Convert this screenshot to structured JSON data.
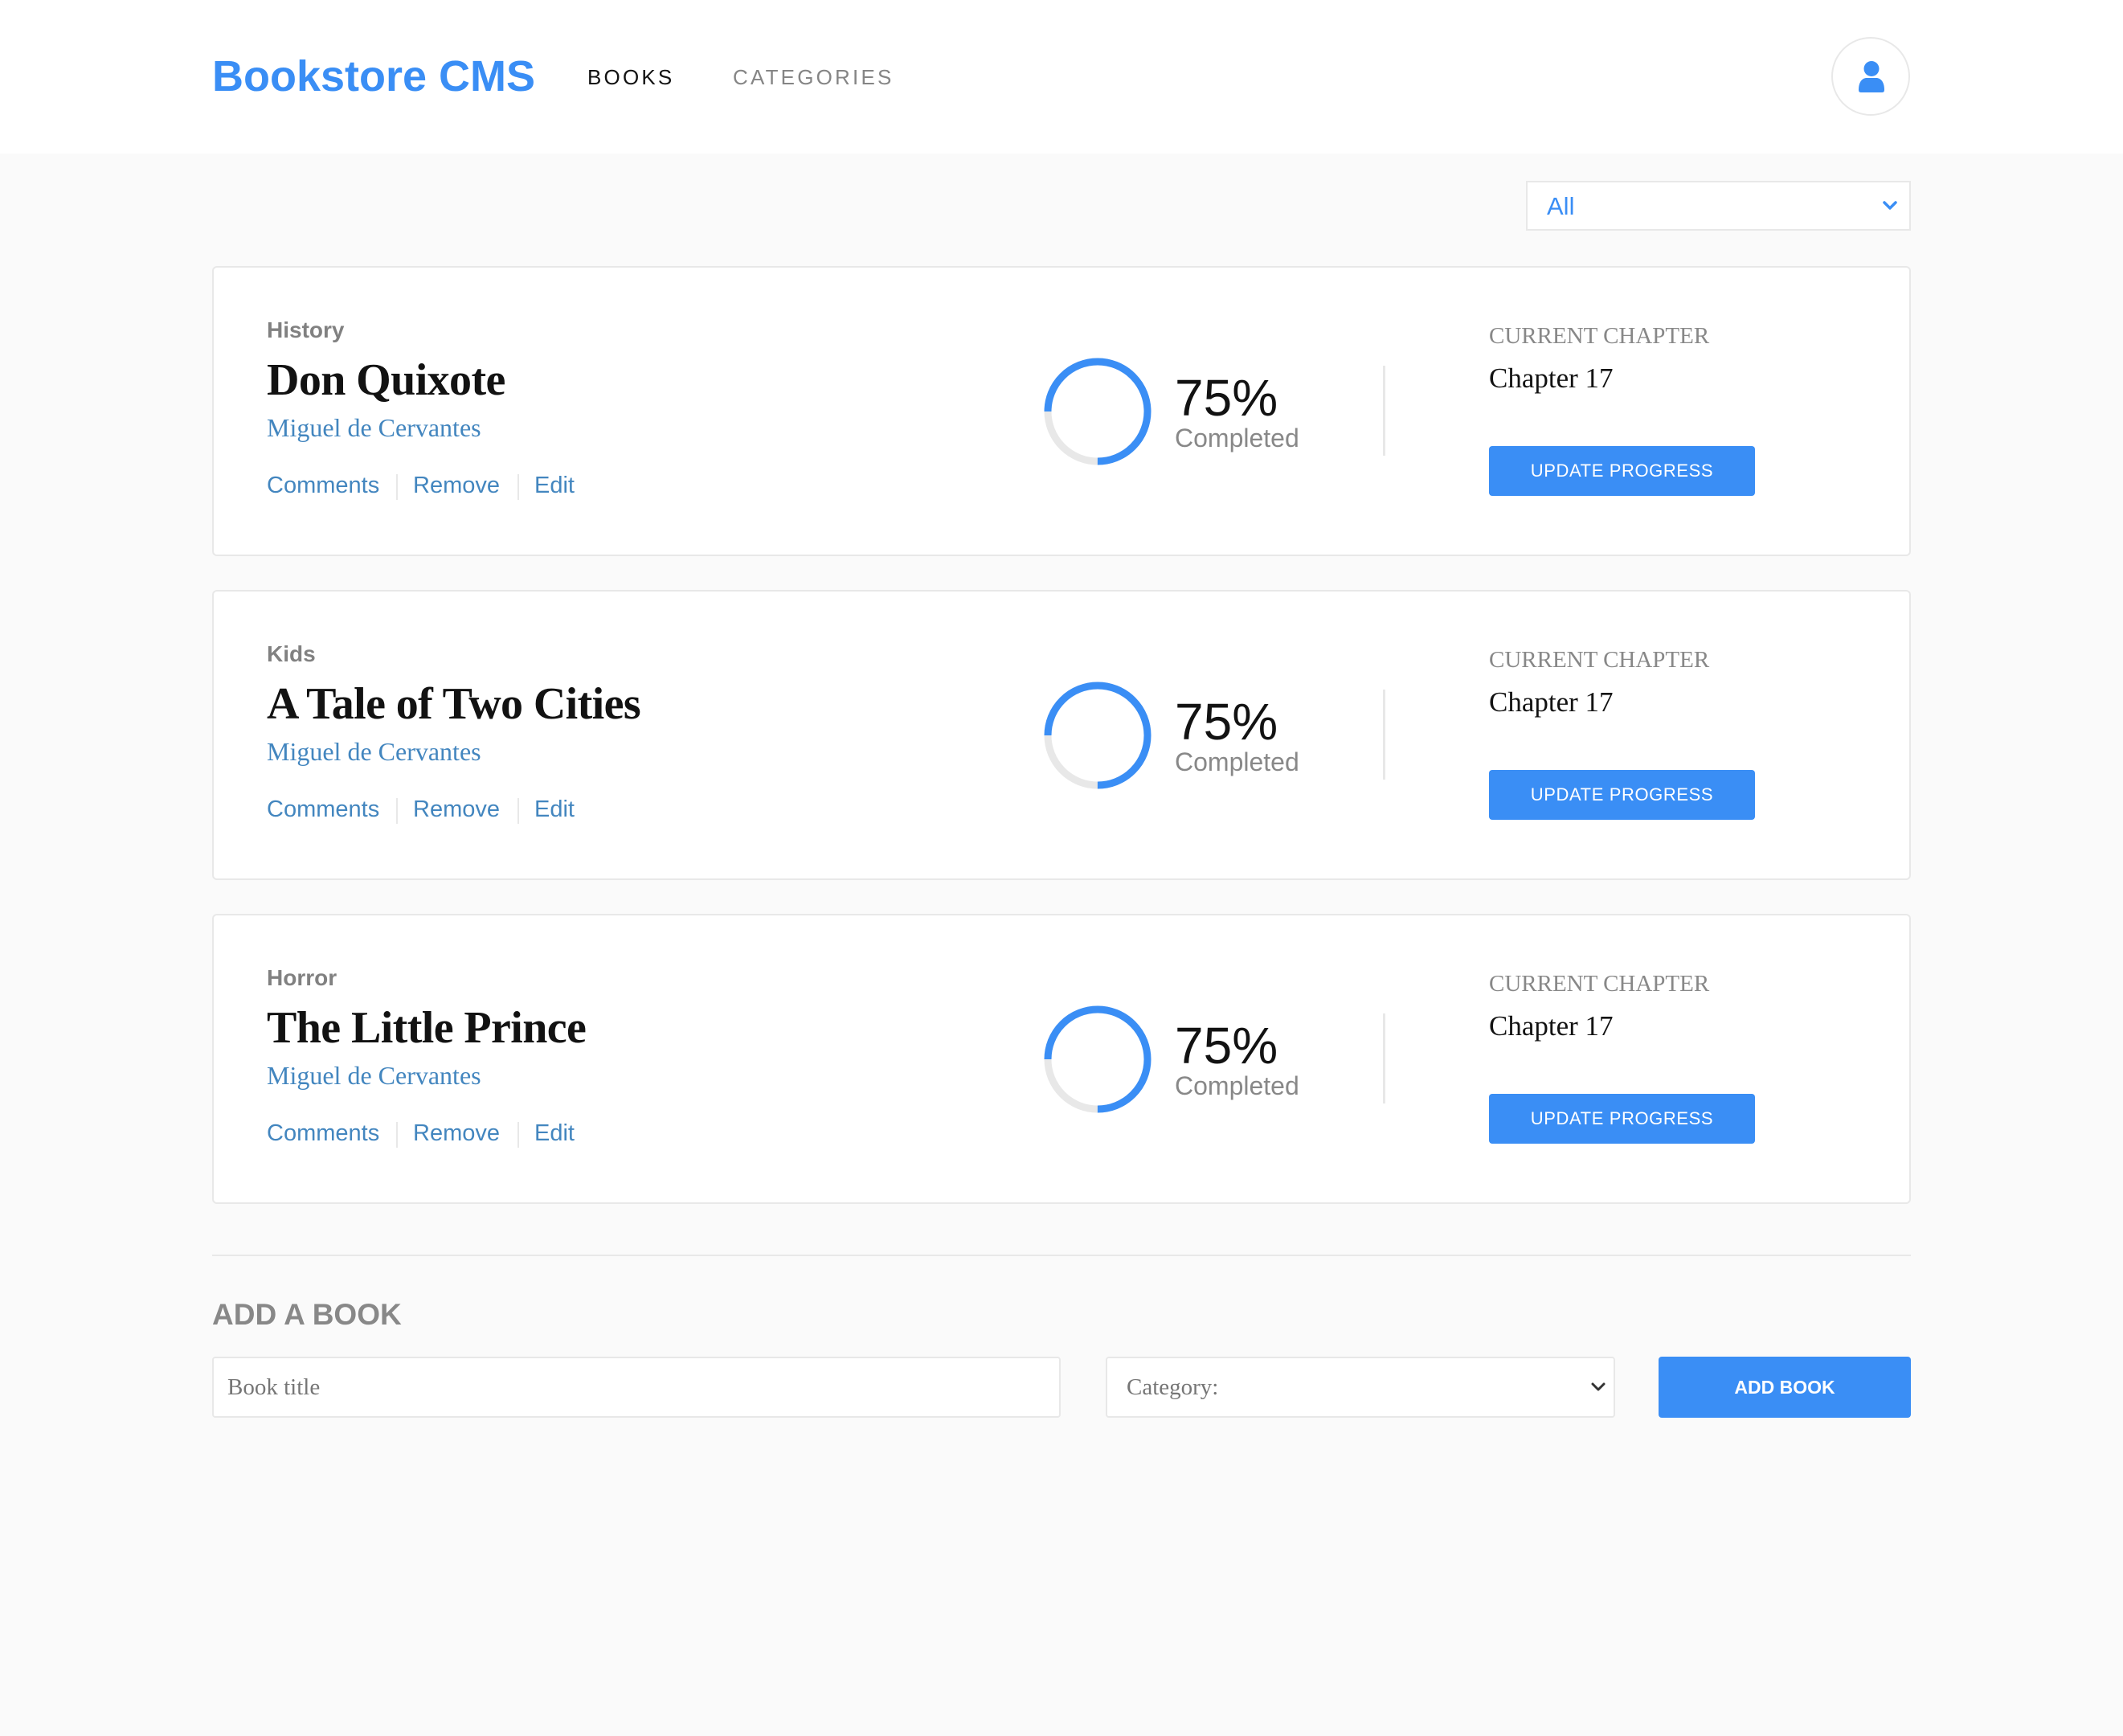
{
  "app": {
    "title": "Bookstore CMS",
    "accent_color": "#3a8ef5",
    "link_color": "#4386bf"
  },
  "nav": {
    "items": [
      {
        "label": "BOOKS",
        "active": true
      },
      {
        "label": "CATEGORIES",
        "active": false
      }
    ],
    "user_icon": "user-icon"
  },
  "filter": {
    "selected": "All"
  },
  "books": [
    {
      "category": "History",
      "title": "Don Quixote",
      "author": "Miguel de Cervantes",
      "actions": [
        "Comments",
        "Remove",
        "Edit"
      ],
      "progress": 0.75,
      "percent_label": "75%",
      "completed_label": "Completed",
      "chapter_label": "CURRENT CHAPTER",
      "chapter": "Chapter 17",
      "update_label": "UPDATE PROGRESS"
    },
    {
      "category": "Kids",
      "title": "A Tale of Two Cities",
      "author": "Miguel de Cervantes",
      "actions": [
        "Comments",
        "Remove",
        "Edit"
      ],
      "progress": 0.75,
      "percent_label": "75%",
      "completed_label": "Completed",
      "chapter_label": "CURRENT CHAPTER",
      "chapter": "Chapter 17",
      "update_label": "UPDATE PROGRESS"
    },
    {
      "category": "Horror",
      "title": "The Little Prince",
      "author": "Miguel de Cervantes",
      "actions": [
        "Comments",
        "Remove",
        "Edit"
      ],
      "progress": 0.75,
      "percent_label": "75%",
      "completed_label": "Completed",
      "chapter_label": "CURRENT CHAPTER",
      "chapter": "Chapter 17",
      "update_label": "UPDATE PROGRESS"
    }
  ],
  "add_book": {
    "heading": "ADD A BOOK",
    "title_placeholder": "Book title",
    "category_placeholder": "Category:",
    "submit_label": "ADD BOOK"
  }
}
